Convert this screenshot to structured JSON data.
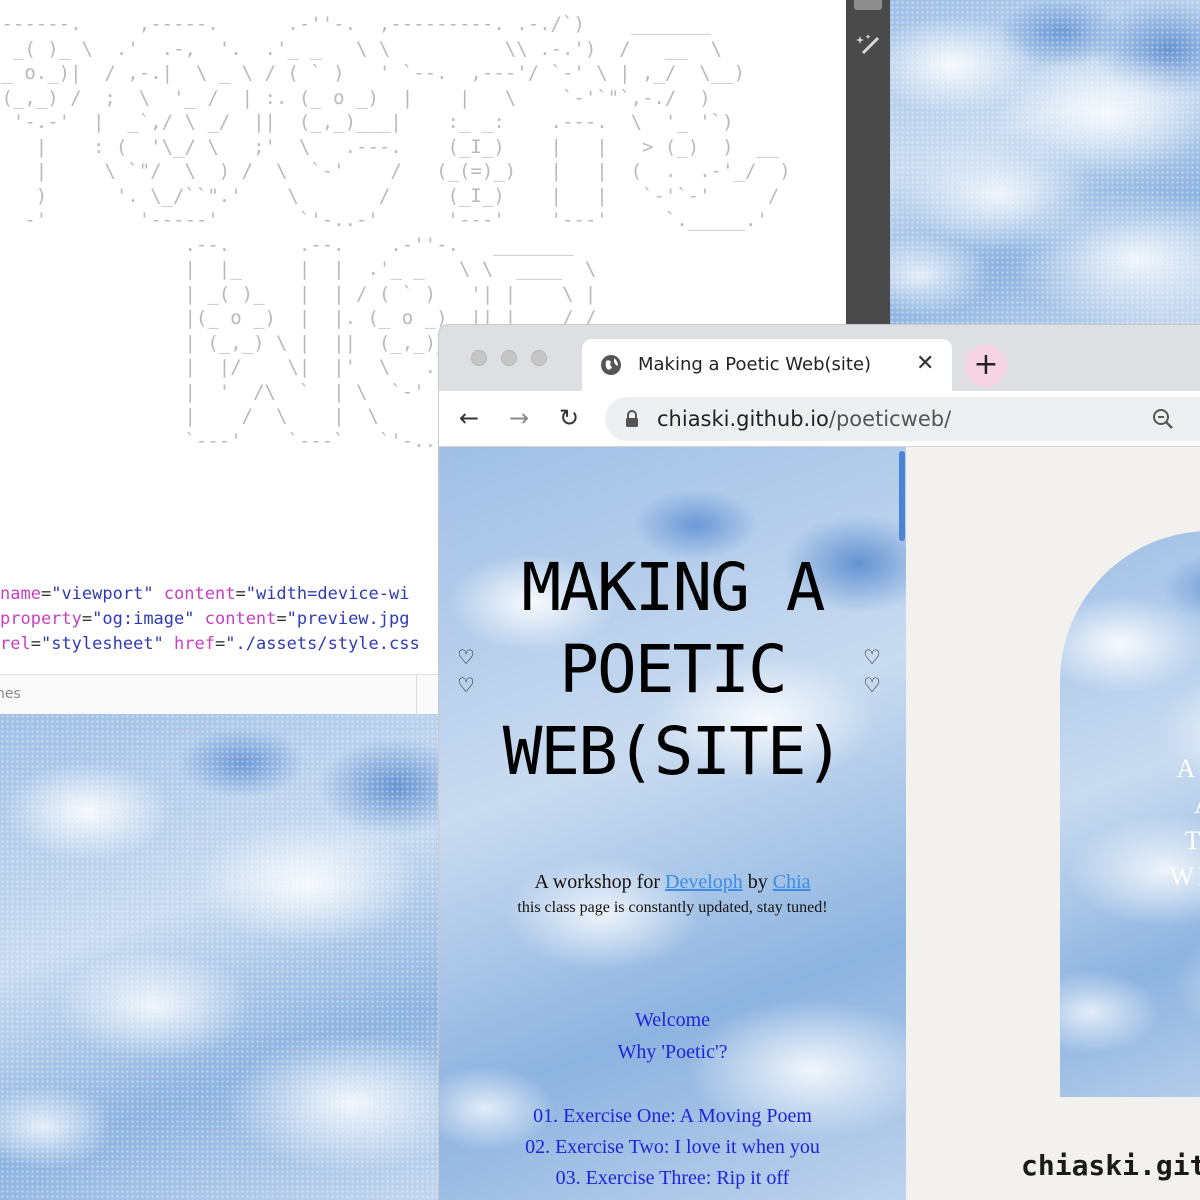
{
  "editor": {
    "ascii_lines": [
      " ------.     ,-----.      .-''-.  ,---------. .-./`)    _______",
      "  _( )_ \\  .'  .-,  '.  .'_ _   \\ \\          \\\\ .-.')  /   __  \\",
      " _ o._)|  / ,-.|  \\ _ \\ / ( ` )   ' `--.  ,---'/ `-' \\ | ,_/  \\__)",
      " (_,_) /  ;  \\  '_ /  | :. (_ o _)  |    |   \\    `-'`\"`,-./  )",
      "  '-.-'  |  _`,/ \\ _/  ||  (_,_)___|    :_ _:    .---.  \\  '_ '`)",
      "    |    : (  '\\_/ \\   ;'  \\   .---.    (_I_)    |   |   > (_)  )  __",
      "    |     \\ `\"/  \\  ) /  \\  `-'    /   (_(=)_)   |   |  (  .  .-'_/  )",
      "    )      '. \\_/``\".'    \\       /     (_I_)    |   |   `-'`-'     /",
      "   -'        '-----'       `'-..-'      '---'    '---'     `._____.'",
      "                 .--.      .--.    .-''-.   _______",
      "                 |  |_     |  |  .'_ _   \\ \\  ____  \\",
      "                 | _( )_   |  | / ( ` )   '| |    \\ |",
      "                 |(_ o _)  |  |. (_ o _)  || |____/ /",
      "                 | (_,_) \\ |  ||  (_,_)___||   _ _ '.",
      "                 |  |/    \\|  |'  \\   .---.|  ( ' )  \\",
      "                 |  '  /\\  `  | \\  `-'    /| (_{;}_) |",
      "                 |    /  \\    |  \\       / |  (_,_)  /",
      "                 `---'    `---`   `'-..-'  /_______.'"
    ],
    "code_lines": [
      {
        "attr": "name",
        "val": "\"viewport\"",
        "attr2": "content",
        "val2": "\"width=device-wi"
      },
      {
        "attr": "property",
        "val": "\"og:image\"",
        "attr2": "content",
        "val2": "\"preview.jpg"
      },
      {
        "attr": "rel",
        "val": "\"stylesheet\"",
        "attr2": "href",
        "val2": "\"./assets/style.css"
      }
    ],
    "status_text": "nes"
  },
  "browser": {
    "tab_title": "Making a Poetic Web(site)",
    "tab_close_label": "✕",
    "new_tab_label": "+",
    "back_label": "←",
    "forward_label": "→",
    "reload_label": "↻",
    "url_host": "chiaski.github.io",
    "url_path": "/poeticweb/"
  },
  "page": {
    "hero_title": "MAKING A POETIC WEB(SITE)",
    "hearts": "♡\n♡",
    "subtitle_prefix": "A workshop for ",
    "subtitle_link1": "Developh",
    "subtitle_mid": " by ",
    "subtitle_link2": "Chia",
    "notice": "this class page is constantly updated, stay tuned!",
    "links": {
      "welcome": "Welcome",
      "why": "Why 'Poetic'?",
      "ex1": "01. Exercise One: A Moving Poem",
      "ex2": "02. Exercise Two: I love it when you",
      "ex3": "03. Exercise Three: Rip it off"
    },
    "arch_text": "A W\nA\nTH\nWHA",
    "site_name": "chiaski.git"
  },
  "colors": {
    "link_blue": "#1d24d8",
    "underline_link": "#3b8ee6",
    "new_tab_pink": "#f7d4e4"
  },
  "icons": [
    "globe-icon",
    "lock-icon",
    "zoom-icon",
    "wand-icon",
    "heart-icon"
  ]
}
